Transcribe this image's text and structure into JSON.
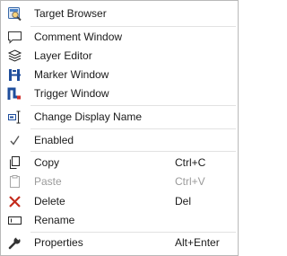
{
  "menu": {
    "items": [
      {
        "label": "Target Browser",
        "shortcut": "",
        "icon": "target-browser-icon"
      },
      {
        "label": "Comment Window",
        "shortcut": "",
        "icon": "comment-icon"
      },
      {
        "label": "Layer Editor",
        "shortcut": "",
        "icon": "layers-icon"
      },
      {
        "label": "Marker Window",
        "shortcut": "",
        "icon": "marker-icon"
      },
      {
        "label": "Trigger Window",
        "shortcut": "",
        "icon": "trigger-icon"
      },
      {
        "label": "Change Display Name",
        "shortcut": "",
        "icon": "rename-cursor-icon"
      },
      {
        "label": "Enabled",
        "shortcut": "",
        "icon": "checkmark-icon",
        "checked": true
      },
      {
        "label": "Copy",
        "shortcut": "Ctrl+C",
        "icon": "copy-icon"
      },
      {
        "label": "Paste",
        "shortcut": "Ctrl+V",
        "icon": "paste-icon",
        "disabled": true
      },
      {
        "label": "Delete",
        "shortcut": "Del",
        "icon": "delete-x-icon"
      },
      {
        "label": "Rename",
        "shortcut": "",
        "icon": "rename-field-icon"
      },
      {
        "label": "Properties",
        "shortcut": "Alt+Enter",
        "icon": "wrench-icon"
      }
    ]
  },
  "colors": {
    "accent_blue": "#1f4e9c",
    "delete_red": "#c42b1c",
    "disabled_text": "#9b9b9b",
    "separator": "#e2e2e2"
  }
}
